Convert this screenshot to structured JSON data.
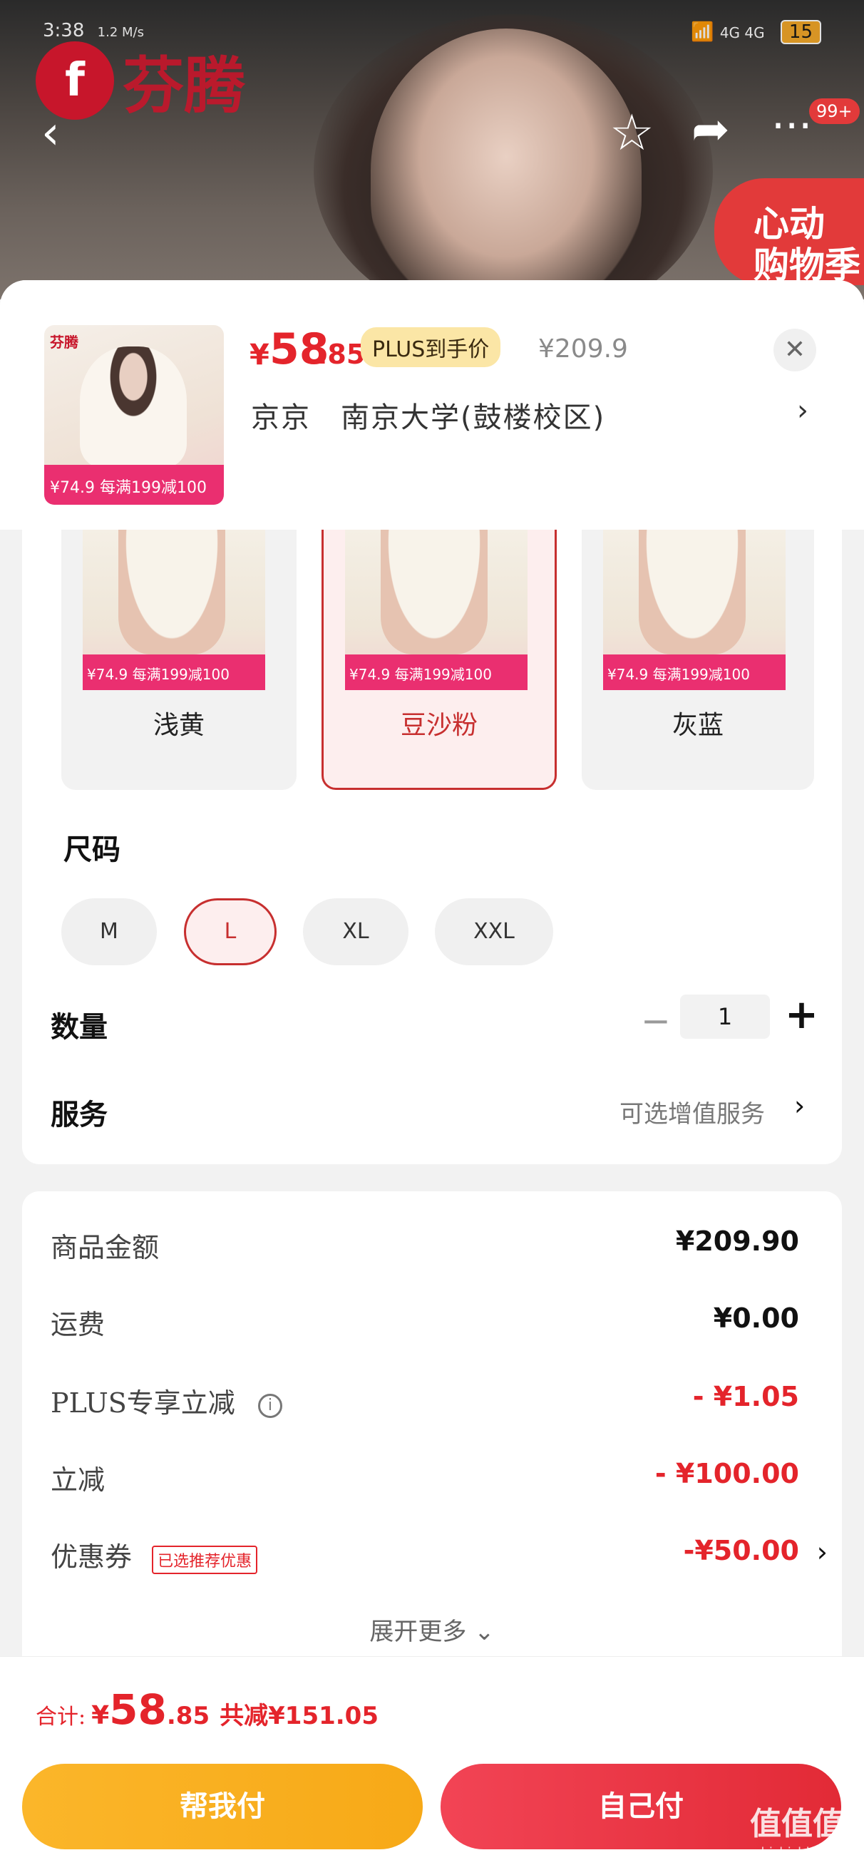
{
  "status_bar": {
    "time": "3:38",
    "net": "1.2 M/s",
    "signal": "4G 4G",
    "battery": "15"
  },
  "hero": {
    "brand_name": "芬腾",
    "brand_glyph": "f",
    "badge": "99+",
    "promo": [
      "心动",
      "购物季"
    ]
  },
  "product": {
    "price_currency": "¥",
    "price_int": "58",
    "price_dec": ".85",
    "plus_tag": "PLUS到手价",
    "original_price": "¥209.9",
    "address": "京京　南京大学(鼓楼校区)",
    "thumb_brand": "芬腾",
    "thumb_promo": "¥74.9  每满199减100"
  },
  "colors": [
    {
      "label": "浅黄",
      "promo": "¥74.9 每满199减100",
      "selected": false
    },
    {
      "label": "豆沙粉",
      "promo": "¥74.9 每满199减100",
      "selected": true
    },
    {
      "label": "灰蓝",
      "promo": "¥74.9 每满199减100",
      "selected": false
    }
  ],
  "size_section": {
    "title": "尺码",
    "options": [
      "M",
      "L",
      "XL",
      "XXL"
    ],
    "selected": "L"
  },
  "quantity": {
    "label": "数量",
    "value": "1",
    "minus": "−",
    "plus": "+"
  },
  "service": {
    "label": "服务",
    "value": "可选增值服务"
  },
  "summary": {
    "rows": [
      {
        "label": "商品金额",
        "value": "¥209.90"
      },
      {
        "label": "运费",
        "value": "¥0.00"
      },
      {
        "label": "PLUS专享立减",
        "value": "- ¥1.05"
      },
      {
        "label": "立减",
        "value": "- ¥100.00"
      },
      {
        "label": "优惠券",
        "value": "-¥50.00"
      }
    ],
    "coupon_tag": "已选推荐优惠",
    "expand": "展开更多"
  },
  "footer": {
    "total_label": "合计:",
    "total_currency": "¥",
    "total_int": "58",
    "total_dec": ".85",
    "saved": "共减¥151.05",
    "btn_help": "帮我付",
    "btn_self": "自己付"
  },
  "watermark": {
    "main": "值值值",
    "sub": "zhizhizhi.com"
  },
  "accent_colors": {
    "red": "#e4242b",
    "brand": "#c7162b",
    "orange": "#f7a917"
  }
}
